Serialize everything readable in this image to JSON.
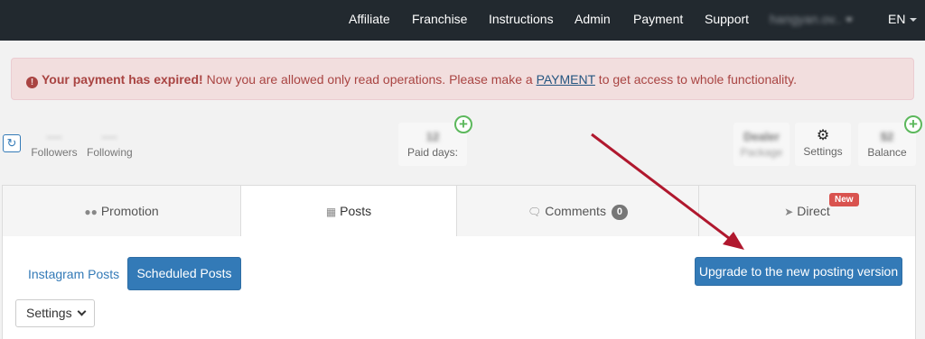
{
  "nav": {
    "items": [
      "Affiliate",
      "Franchise",
      "Instructions",
      "Admin",
      "Payment",
      "Support"
    ],
    "user": "hangyan.ov..",
    "lang": "EN"
  },
  "alert": {
    "strong": "Your payment has expired!",
    "text": " Now you are allowed only read operations. Please make a ",
    "link": "PAYMENT",
    "tail": " to get access to whole functionality."
  },
  "stats": {
    "followers_value": "----",
    "followers_label": "Followers",
    "following_value": "----",
    "following_label": "Following",
    "paid_days_value": "12",
    "paid_days_label": "Paid days:",
    "package_value": "Dealer",
    "package_label": "Package",
    "settings_label": "Settings",
    "balance_value": "$2",
    "balance_label": "Balance"
  },
  "tabs": {
    "promotion": "Promotion",
    "posts": "Posts",
    "comments": "Comments",
    "comments_count": "0",
    "direct": "Direct",
    "new_badge": "New"
  },
  "posts": {
    "instagram_posts": "Instagram Posts",
    "scheduled_posts": "Scheduled Posts",
    "upgrade": "Upgrade to the new posting version",
    "settings_dropdown": "Settings"
  },
  "colors": {
    "nav_bg": "#22292f",
    "primary": "#337ab7",
    "alert_bg": "#f2dede",
    "alert_text": "#a94442",
    "success": "#5cb85c",
    "danger": "#d9534f",
    "arrow": "#b0182e"
  }
}
